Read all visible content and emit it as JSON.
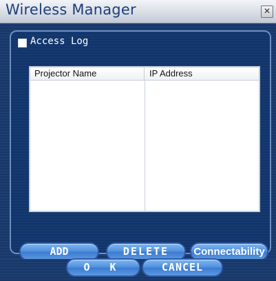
{
  "window": {
    "title": "Wireless Manager",
    "close_symbol": "✕"
  },
  "access_log": {
    "label": "Access Log",
    "checked": false
  },
  "list": {
    "columns": [
      "Projector Name",
      "IP Address"
    ],
    "rows": []
  },
  "buttons": {
    "add": "ADD",
    "delete": "DELETE",
    "connectability": "Connectability",
    "ok": "O K",
    "cancel": "CANCEL"
  },
  "colors": {
    "background": "#1b3b6b",
    "button_blue": "#4e8fdc",
    "title_text": "#1d3f7a"
  },
  "icons": {
    "close": "close-icon",
    "checkbox": "checkbox-icon"
  }
}
